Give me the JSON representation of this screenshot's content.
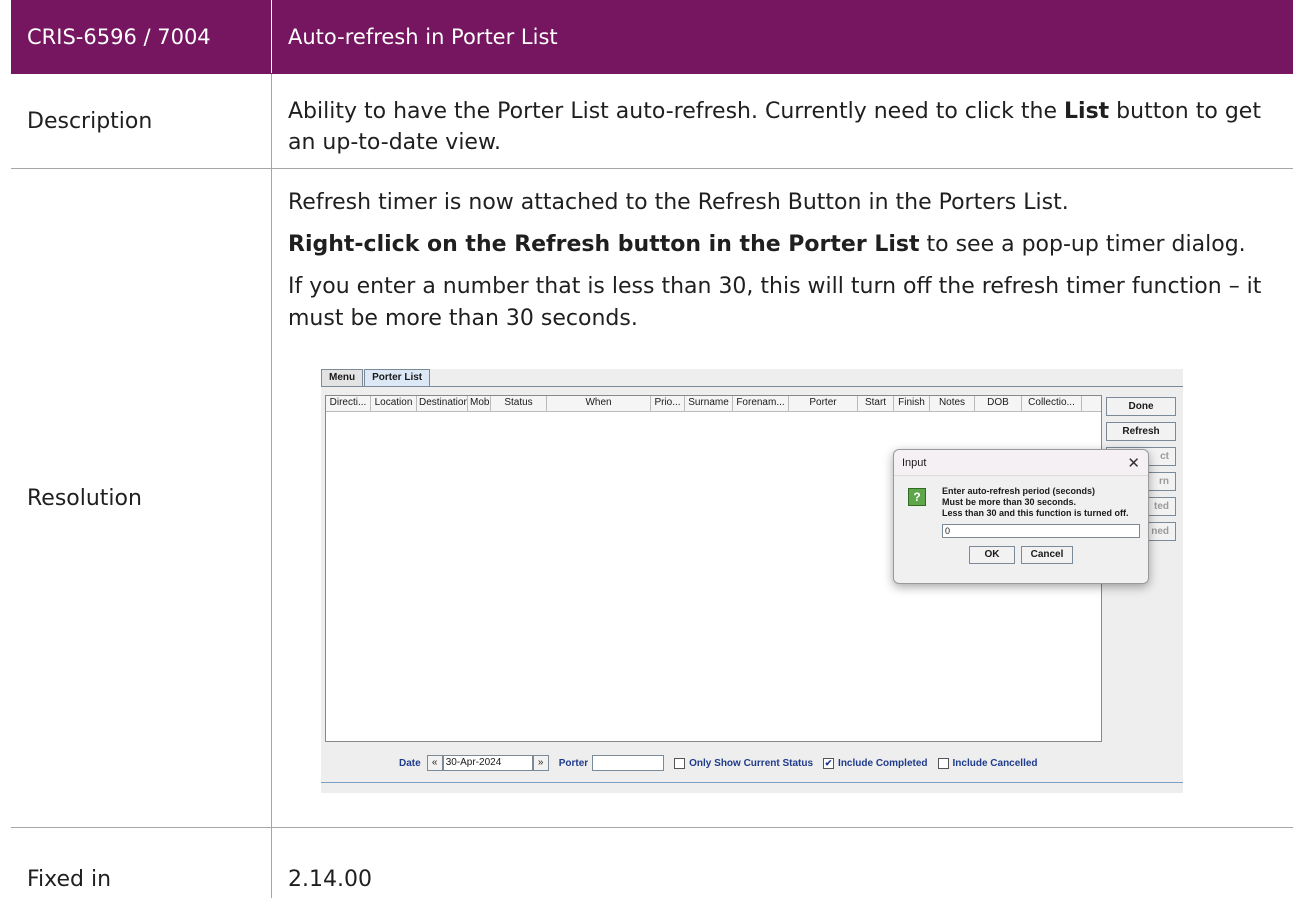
{
  "header": {
    "id": "CRIS-6596 / 7004",
    "title": "Auto-refresh in Porter List"
  },
  "description": {
    "label": "Description",
    "text_before": "Ability to have the Porter List auto-refresh. Currently need to click the ",
    "bold": "List",
    "text_after": " button to get an up-to-date view."
  },
  "resolution": {
    "label": "Resolution",
    "p1": "Refresh timer is now attached to the Refresh Button in the Porters List.",
    "p2_bold": "Right-click on the Refresh button in the Porter List",
    "p2_rest": " to see a pop-up timer dialog.",
    "p3": "If you enter a number that is less than 30, this will turn off the refresh timer function – it must be more than 30 seconds."
  },
  "fixed": {
    "label": "Fixed in",
    "value": "2.14.00"
  },
  "app": {
    "tabs": [
      "Menu",
      "Porter List"
    ],
    "columns": [
      "Directi...",
      "Location",
      "Destination",
      "Mob",
      "Status",
      "When",
      "Prio...",
      "Surname",
      "Forenam...",
      "Porter",
      "Start",
      "Finish",
      "Notes",
      "DOB",
      "Collectio..."
    ],
    "buttons": [
      "Done",
      "Refresh",
      "ct",
      "rn",
      "ted",
      "ned"
    ],
    "footer": {
      "date_label": "Date",
      "date_value": "30-Apr-2024",
      "porter_label": "Porter",
      "only_current": "Only Show Current Status",
      "include_completed": "Include Completed",
      "include_cancelled": "Include Cancelled"
    },
    "dialog": {
      "title": "Input",
      "line1": "Enter auto-refresh period (seconds)",
      "line2": "Must be more than 30 seconds.",
      "line3": "Less than 30 and this function is turned off.",
      "value": "0",
      "ok": "OK",
      "cancel": "Cancel"
    }
  }
}
